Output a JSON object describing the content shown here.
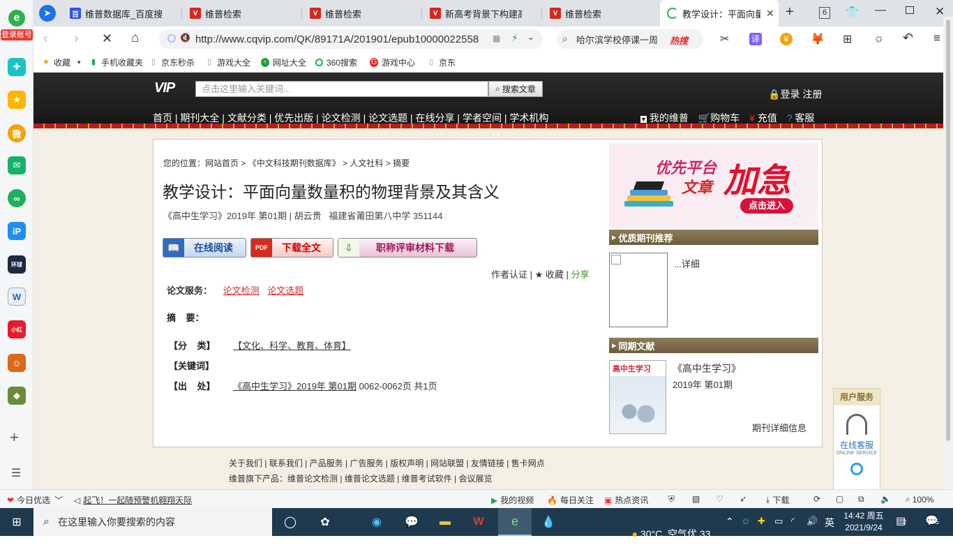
{
  "browser": {
    "login_label": "登录账号",
    "tabs": [
      {
        "title": "维普数据库_百度搜索"
      },
      {
        "title": "维普检索"
      },
      {
        "title": "维普检索"
      },
      {
        "title": "新高考背景下构建高"
      },
      {
        "title": "维普检索"
      },
      {
        "title": "教学设计：平面向量"
      }
    ],
    "tab_count": "6",
    "url": "http://www.cqvip.com/QK/89171A/201901/epub10000022558",
    "search_text": "哈尔滨学校停课一周",
    "hot_label": "热搜",
    "translate_label": "译"
  },
  "bookmarks": [
    {
      "label": "收藏"
    },
    {
      "label": "手机收藏夹"
    },
    {
      "label": "京东秒杀"
    },
    {
      "label": "游戏大全"
    },
    {
      "label": "网址大全"
    },
    {
      "label": "360搜索"
    },
    {
      "label": "游戏中心"
    },
    {
      "label": "京东"
    }
  ],
  "site": {
    "logo": "VIP",
    "search_placeholder": "点击这里输入关键词...",
    "search_button": "搜索文章",
    "login": "登录 注册",
    "nav": [
      "首页",
      "期刊大全",
      "文献分类",
      "优先出版",
      "论文检测",
      "论文选题",
      "在线分享",
      "学者空间",
      "学术机构"
    ],
    "user_links": [
      "我的维普",
      "购物车",
      "充值",
      "客服"
    ]
  },
  "article": {
    "breadcrumb_prefix": "您的位置：",
    "breadcrumb": [
      "网站首页",
      "《中文科技期刊数据库》",
      "人文社科",
      "摘要"
    ],
    "title": "教学设计：平面向量数量积的物理背景及其含义",
    "meta": "《高中生学习》2019年 第01期 | 胡云贵   福建省莆田第八中学 351144",
    "btn_read": "在线阅读",
    "btn_download": "下载全文",
    "btn_title_material": "职称评审材料下载",
    "author_cert": "作者认证",
    "favorite": "★ 收藏",
    "share": "分享",
    "service_label": "论文服务：",
    "service_links": [
      "论文检测",
      "论文选题"
    ],
    "abstract_label": "摘    要：",
    "class_label": "【分    类】",
    "class_value": "【文化、科学、教育、体育】",
    "keywords_label": "【关键词】",
    "source_label": "【出    处】",
    "source_link": "《高中生学习》2019年 第01期",
    "source_pages": "0062-0062页 共1页"
  },
  "sidebar": {
    "banner_line1": "优先平台",
    "banner_line2": "文章",
    "banner_big": "加急",
    "banner_btn": "点击进入",
    "rec_header": "优质期刊推荐",
    "rec_detail": "...详细",
    "same_header": "同期文献",
    "journal_cover_title": "高中生学习",
    "journal_name": "《高中生学习》",
    "journal_issue": "2019年 第01期",
    "journal_detail": "期刊详细信息"
  },
  "service_widget": {
    "title": "用户服务",
    "online": "在线客服",
    "online_en": "ONLINE SERVICE"
  },
  "footer": {
    "links": [
      "关于我们",
      "联系我们",
      "产品服务",
      "广告服务",
      "版权声明",
      "网站联盟",
      "友情链接",
      "售卡网点"
    ],
    "products_prefix": "维普旗下产品：",
    "products": [
      "维普论文检测",
      "维普论文选题",
      "维普考试软件",
      "会议展览"
    ]
  },
  "statusbar": {
    "daily": "今日优选",
    "news": "起飞！一起随预警机翱翔天际",
    "video": "我的视频",
    "focus": "每日关注",
    "hot_news": "热点资讯",
    "download": "下载",
    "zoom": "100%"
  },
  "taskbar": {
    "search_placeholder": "在这里输入你要搜索的内容",
    "weather": "30°C  空气优 33",
    "ime": "英",
    "time": "14:42 周五",
    "date": "2021/9/24",
    "notifications": "2",
    "chat_badge": "5"
  }
}
